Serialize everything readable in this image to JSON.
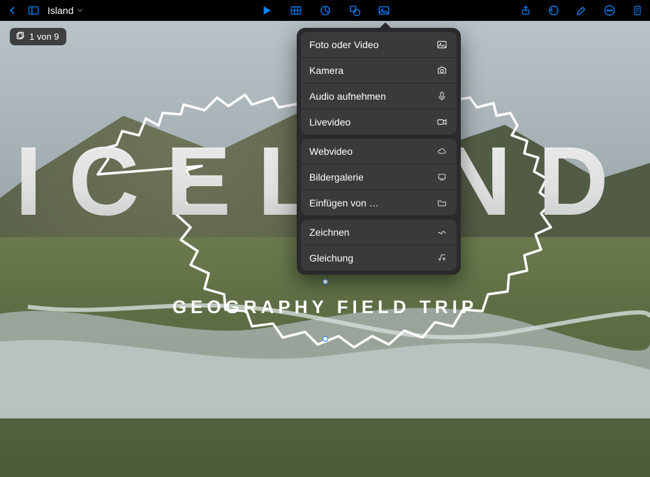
{
  "toolbar": {
    "doc_title": "Island"
  },
  "slide_badge": {
    "text": "1 von 9"
  },
  "slide": {
    "title": "ICELAND",
    "subtitle": "GEOGRAPHY FIELD TRIP"
  },
  "menu": {
    "group1": [
      {
        "label": "Foto oder Video",
        "icon": "photo-icon"
      },
      {
        "label": "Kamera",
        "icon": "camera-icon"
      },
      {
        "label": "Audio aufnehmen",
        "icon": "microphone-icon"
      },
      {
        "label": "Livevideo",
        "icon": "video-camera-icon"
      }
    ],
    "group2": [
      {
        "label": "Webvideo",
        "icon": "cloud-icon"
      },
      {
        "label": "Bildergalerie",
        "icon": "gallery-icon"
      },
      {
        "label": "Einfügen von …",
        "icon": "folder-icon"
      }
    ],
    "group3": [
      {
        "label": "Zeichnen",
        "icon": "scribble-icon"
      },
      {
        "label": "Gleichung",
        "icon": "equation-icon"
      }
    ]
  }
}
